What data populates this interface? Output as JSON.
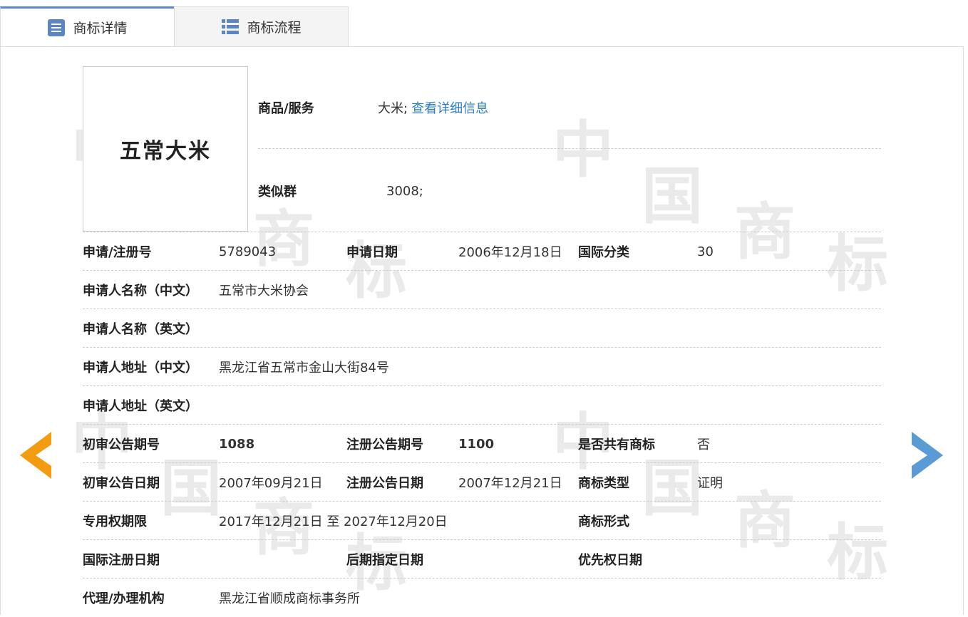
{
  "tabs": [
    {
      "label": "商标详情",
      "icon": "list-doc-icon",
      "active": true
    },
    {
      "label": "商标流程",
      "icon": "list-bullets-icon",
      "active": false
    }
  ],
  "watermark": {
    "chars": [
      "中",
      "国",
      "商",
      "标"
    ]
  },
  "logo": {
    "text": "五常大米"
  },
  "goods": {
    "label": "商品/服务",
    "value": "大米;",
    "link": "查看详细信息"
  },
  "similar": {
    "label": "类似群",
    "value": "3008;"
  },
  "rows": [
    [
      {
        "label": "申请/注册号",
        "value": "5789043"
      },
      {
        "label": "申请日期",
        "value": "2006年12月18日"
      },
      {
        "label": "国际分类",
        "value": "30"
      }
    ],
    [
      {
        "label": "申请人名称（中文）",
        "value": "五常市大米协会"
      }
    ],
    [
      {
        "label": "申请人名称（英文）",
        "value": ""
      }
    ],
    [
      {
        "label": "申请人地址（中文）",
        "value": "黑龙江省五常市金山大街84号"
      }
    ],
    [
      {
        "label": "申请人地址（英文）",
        "value": ""
      }
    ],
    [
      {
        "label": "初审公告期号",
        "value": "1088",
        "bold": true
      },
      {
        "label": "注册公告期号",
        "value": "1100",
        "bold": true
      },
      {
        "label": "是否共有商标",
        "value": "否"
      }
    ],
    [
      {
        "label": "初审公告日期",
        "value": "2007年09月21日"
      },
      {
        "label": "注册公告日期",
        "value": "2007年12月21日"
      },
      {
        "label": "商标类型",
        "value": "证明"
      }
    ],
    [
      {
        "label": "专用权期限",
        "value": "2017年12月21日 至 2027年12月20日"
      },
      {
        "label": "商标形式",
        "value": "",
        "wide": true
      }
    ],
    [
      {
        "label": "国际注册日期",
        "value": ""
      },
      {
        "label": "后期指定日期",
        "value": ""
      },
      {
        "label": "优先权日期",
        "value": ""
      }
    ],
    [
      {
        "label": "代理/办理机构",
        "value": "黑龙江省顺成商标事务所"
      }
    ]
  ],
  "colors": {
    "accent": "#5b86c5",
    "prev": "#f39c12",
    "next": "#5b9bd5",
    "link": "#2b7cc9"
  },
  "nav": {
    "prev_icon": "prev-arrow-icon",
    "next_icon": "next-arrow-icon"
  }
}
